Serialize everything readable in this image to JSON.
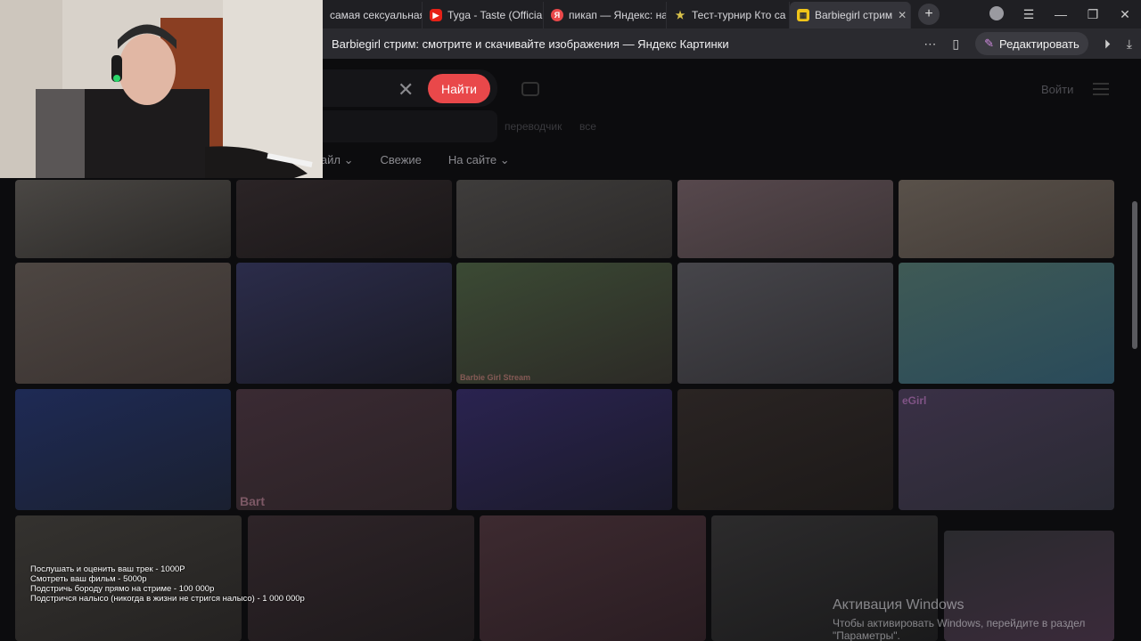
{
  "tabs": [
    {
      "title": "самая сексуальная д",
      "fav_color": "",
      "fav_glyph": ""
    },
    {
      "title": "Tyga - Taste (Official",
      "fav_color": "#e62117",
      "fav_glyph": "▶"
    },
    {
      "title": "пикап — Яндекс: на",
      "fav_color": "#e9484a",
      "fav_glyph": "Я"
    },
    {
      "title": "Тест-турнир Кто са",
      "fav_color": "#d9c24a",
      "fav_glyph": "★"
    },
    {
      "title": "Barbiegirl стрим",
      "fav_color": "#f0c419",
      "fav_glyph": "▦",
      "active": true
    }
  ],
  "address_bar": {
    "page_title": "Barbiegirl стрим: смотрите и скачивайте изображения — Яндекс Картинки",
    "edit_label": "Редактировать"
  },
  "search": {
    "find_label": "Найти",
    "login_label": "Войти",
    "suggestions": [
      "переводчик",
      "все"
    ]
  },
  "filters": [
    "Файл",
    "Свежие",
    "На сайте"
  ],
  "watermarks": {
    "barbie_girl": "Barbie Girl Stream",
    "bart": "Bart",
    "egirl": "eGirl"
  },
  "price_list": [
    "Послушать и оценить ваш трек - 1000Р",
    "Смотреть ваш фильм - 5000р",
    "Подстричь бороду прямо на стриме - 100 000р",
    "Подстричся налысо (никогда в жизни не стригся налысо) - 1 000 000р"
  ],
  "windows_activation": {
    "title": "Активация Windows",
    "line1": "Чтобы активировать Windows, перейдите в раздел",
    "line2": "\"Параметры\"."
  },
  "colors": {
    "accent": "#e9484a",
    "tab_bar": "#1f1f23",
    "page_bg": "#0c0c0e"
  },
  "icons": [
    "close-icon",
    "camera-icon",
    "menu-icon",
    "bookmark-icon",
    "more-icon",
    "download-icon",
    "play-icon",
    "minimize-icon",
    "maximize-icon",
    "new-tab-icon"
  ]
}
